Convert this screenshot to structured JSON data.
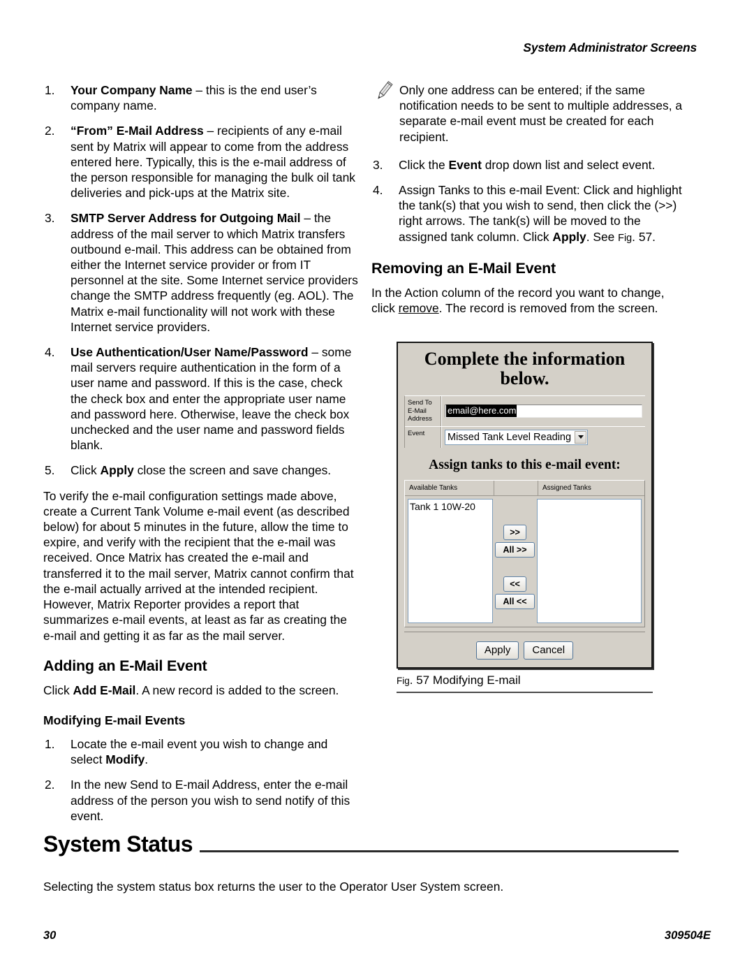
{
  "header": {
    "running_title": "System Administrator Screens"
  },
  "left_column": {
    "config_list": [
      {
        "num": "1.",
        "bold": "Your Company Name",
        "rest": " – this is the end user’s company name."
      },
      {
        "num": "2.",
        "bold": "“From” E-Mail Address",
        "rest": " – recipients of any e-mail sent by Matrix will appear to come from the address entered here. Typically, this is the e-mail address of the person responsible for managing the bulk oil tank deliveries and pick-ups at the Matrix site."
      },
      {
        "num": "3.",
        "bold": "SMTP Server Address for Outgoing Mail",
        "rest": " – the address of the mail server to which Matrix transfers outbound e-mail. This address can be obtained from either the Internet service provider or from IT personnel at the site. Some Internet service providers change the SMTP address frequently (eg. AOL). The Matrix e-mail functionality will not work with these Internet service providers."
      },
      {
        "num": "4.",
        "bold": "Use Authentication/User Name/Password",
        "rest": " – some mail servers require authentication in the form of a user name and password. If this is the case, check the check box and enter the appropriate user name and password here. Otherwise, leave the check box unchecked and the user name and password fields blank."
      }
    ],
    "item5": {
      "num": "5.",
      "pre": "Click ",
      "bold": "Apply",
      "rest": " close the screen and save changes."
    },
    "verify_paragraph": "To verify the e-mail configuration settings made above, create a Current Tank Volume e-mail event (as described below) for about 5 minutes in the future, allow the time to expire, and verify with the recipient that the e-mail was received. Once Matrix has created the e-mail and transferred it to the mail server, Matrix cannot confirm that the e-mail actually arrived at the intended recipient. However, Matrix Reporter provides a report that summarizes e-mail events, at least as far as creating the e-mail and getting it as far as the mail server.",
    "adding_heading": "Adding an E-Mail Event",
    "adding_text": {
      "pre": "Click ",
      "bold": "Add E-Mail",
      "rest": ". A new record is added to the screen."
    },
    "modifying_heading": "Modifying E-mail Events",
    "modifying_list": [
      {
        "num": "1.",
        "pre": "Locate the e-mail event you wish to change and select ",
        "bold": "Modify",
        "rest": "."
      },
      {
        "num": "2.",
        "pre": "In the new Send to E-mail Address, enter the e-mail address of the person you wish to send notify of this event.",
        "bold": "",
        "rest": ""
      }
    ]
  },
  "right_column": {
    "note": "Only one address can be entered; if the same notification needs to be sent to multiple addresses, a separate e-mail event must be created for each recipient.",
    "note_icon": "pencil-icon",
    "steps": [
      {
        "num": "3.",
        "pre": "Click the ",
        "bold": "Event",
        "rest": " drop down list and select event.",
        "bold2": "",
        "rest2": "",
        "smallcaps": ""
      },
      {
        "num": "4.",
        "pre": "Assign Tanks to this e-mail Event: Click and highlight the tank(s) that you wish to send, then click the (>>) right arrows. The tank(s) will be moved to the assigned tank column. Click ",
        "bold": "Apply",
        "rest": ". See ",
        "smallcaps": "Fig",
        "rest2": ". 57."
      }
    ],
    "removing_heading": "Removing an E-Mail Event",
    "removing_text": {
      "pre": "In the Action column of the record you want to change, click ",
      "underline": "remove",
      "rest": ". The record is removed from the screen."
    }
  },
  "figure": {
    "window_title_line1": "Complete the information",
    "window_title_line2": "below.",
    "send_to_label": "Send To E-Mail Address",
    "send_to_value": "email@here.com",
    "event_label": "Event",
    "event_value": "Missed Tank Level Reading",
    "assign_title": "Assign tanks to this e-mail event:",
    "available_header": "Available Tanks",
    "middle_header": "",
    "assigned_header": "Assigned Tanks",
    "available_tanks": [
      "Tank 1 10W-20"
    ],
    "assigned_tanks": [],
    "move_right_label": ">>",
    "move_all_right_label": "All >>",
    "move_left_label": "<<",
    "move_all_left_label": "All <<",
    "apply_label": "Apply",
    "cancel_label": "Cancel",
    "caption_fig": "Fig",
    "caption_rest": ". 57 Modifying E-mail"
  },
  "bottom_section": {
    "heading": "System Status",
    "text": "Selecting the system status box returns the user to the Operator User System screen."
  },
  "footer": {
    "page_number": "30",
    "doc_number": "309504E"
  }
}
